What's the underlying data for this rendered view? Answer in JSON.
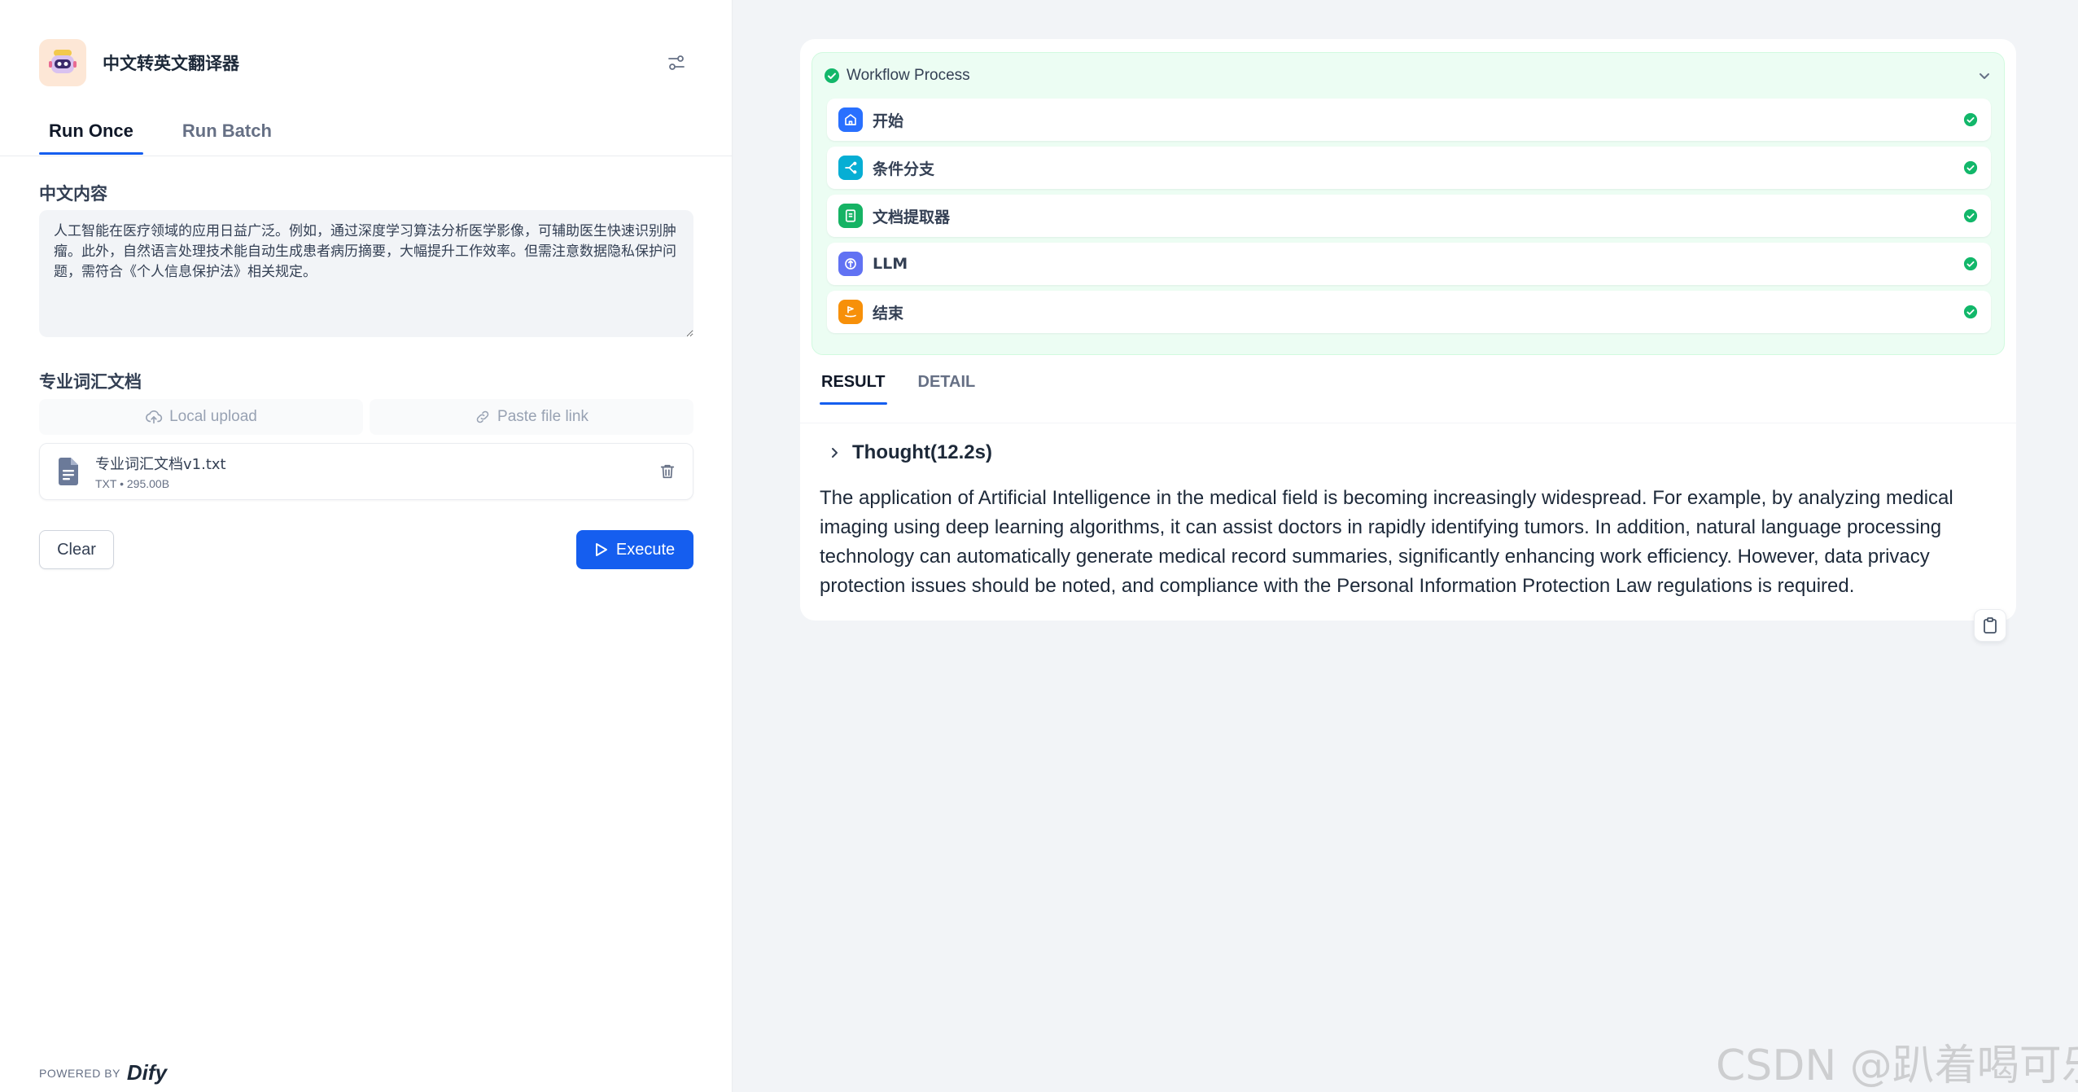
{
  "app": {
    "title": "中文转英文翻译器",
    "icon": "robot-icon"
  },
  "tabs": [
    {
      "label": "Run Once",
      "active": true
    },
    {
      "label": "Run Batch",
      "active": false
    }
  ],
  "form": {
    "text_label": "中文内容",
    "text_value": "人工智能在医疗领域的应用日益广泛。例如，通过深度学习算法分析医学影像，可辅助医生快速识别肿瘤。此外，自然语言处理技术能自动生成患者病历摘要，大幅提升工作效率。但需注意数据隐私保护问题，需符合《个人信息保护法》相关规定。",
    "file_label": "专业词汇文档",
    "local_upload": "Local upload",
    "paste_link": "Paste file link",
    "file": {
      "name": "专业词汇文档v1.txt",
      "type": "TXT",
      "separator": "•",
      "size": "295.00B"
    },
    "clear_label": "Clear",
    "execute_label": "Execute"
  },
  "footer": {
    "powered_by": "POWERED BY",
    "brand": "Dify"
  },
  "workflow": {
    "title": "Workflow Process",
    "nodes": [
      {
        "label": "开始",
        "icon": "home-icon",
        "color": "#2970ff"
      },
      {
        "label": "条件分支",
        "icon": "branch-icon",
        "color": "#06aed4"
      },
      {
        "label": "文档提取器",
        "icon": "doc-extractor-icon",
        "color": "#16b364"
      },
      {
        "label": "LLM",
        "icon": "llm-icon",
        "color": "#6172f3"
      },
      {
        "label": "结束",
        "icon": "end-icon",
        "color": "#f79009"
      }
    ]
  },
  "result_tabs": [
    {
      "label": "RESULT",
      "active": true
    },
    {
      "label": "DETAIL",
      "active": false
    }
  ],
  "result": {
    "thought_label": "Thought(12.2s)",
    "text": "The application of Artificial Intelligence in the medical field is becoming increasingly widespread. For example, by analyzing medical imaging using deep learning algorithms, it can assist doctors in rapidly identifying tumors. In addition, natural language processing technology can automatically generate medical record summaries, significantly enhancing work efficiency. However, data privacy protection issues should be noted, and compliance with the Personal Information Protection Law regulations is required."
  },
  "watermark": "CSDN @趴着喝可乐"
}
